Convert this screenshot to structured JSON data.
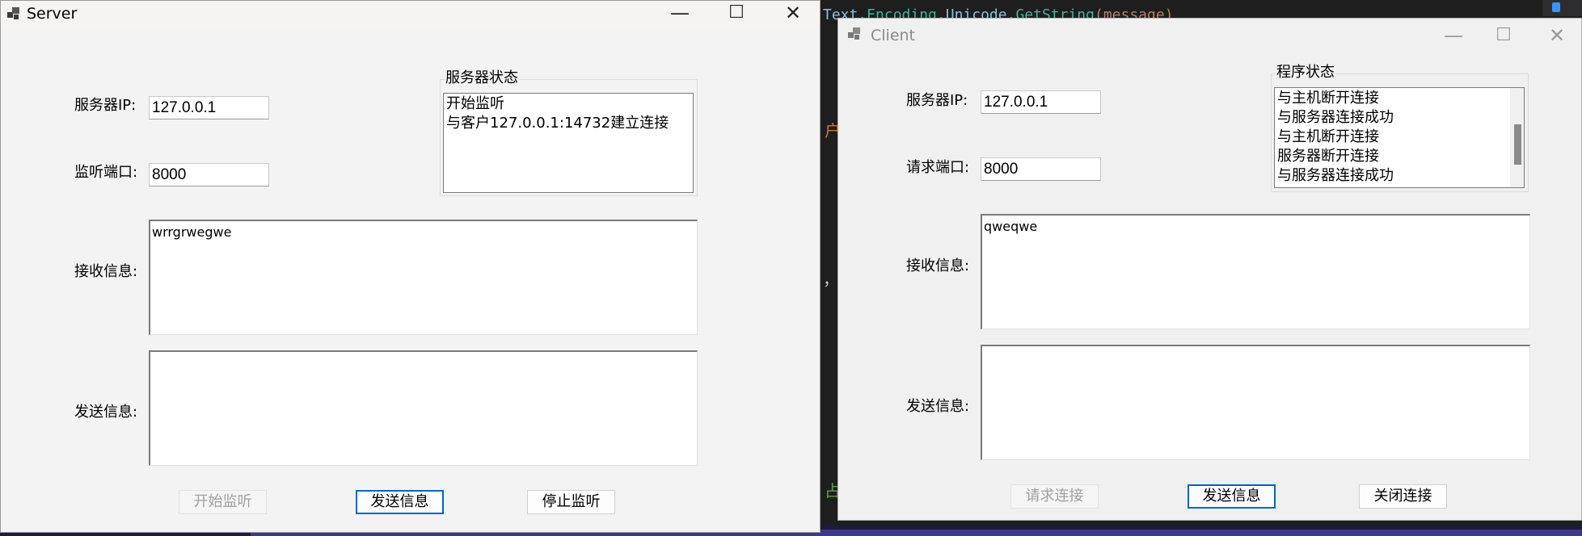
{
  "background": {
    "code_line": "Text.Encoding.Unicode.GetString(message)",
    "code_parts": [
      "Text.",
      "Encoding.",
      "Unicode.",
      "GetString",
      "(message)"
    ],
    "glyph_1": "户",
    "glyph_2": "，",
    "glyph_3": "占"
  },
  "server": {
    "title": "Server",
    "minimize_glyph": "—",
    "maximize_glyph": "☐",
    "close_glyph": "✕",
    "ip_label": "服务器IP:",
    "ip_value": "127.0.0.1",
    "port_label": "监听端口:",
    "port_value": "8000",
    "status_group_title": "服务器状态",
    "status_lines": [
      "开始监听",
      "与客户127.0.0.1:14732建立连接"
    ],
    "receive_label": "接收信息:",
    "receive_text": "wrrgrwegwe",
    "send_label": "发送信息:",
    "send_text": "",
    "start_button": "开始监听",
    "send_button": "发送信息",
    "stop_button": "停止监听"
  },
  "client": {
    "title": "Client",
    "minimize_glyph": "—",
    "maximize_glyph": "☐",
    "close_glyph": "✕",
    "ip_label": "服务器IP:",
    "ip_value": "127.0.0.1",
    "port_label": "请求端口:",
    "port_value": "8000",
    "status_group_title": "程序状态",
    "status_lines": [
      "与主机断开连接",
      "与服务器连接成功",
      "与主机断开连接",
      "服务器断开连接",
      "与服务器连接成功"
    ],
    "receive_label": "接收信息:",
    "receive_text": "qweqwe",
    "send_label": "发送信息:",
    "send_text": "",
    "connect_button": "请求连接",
    "send_button": "发送信息",
    "close_button": "关闭连接"
  }
}
